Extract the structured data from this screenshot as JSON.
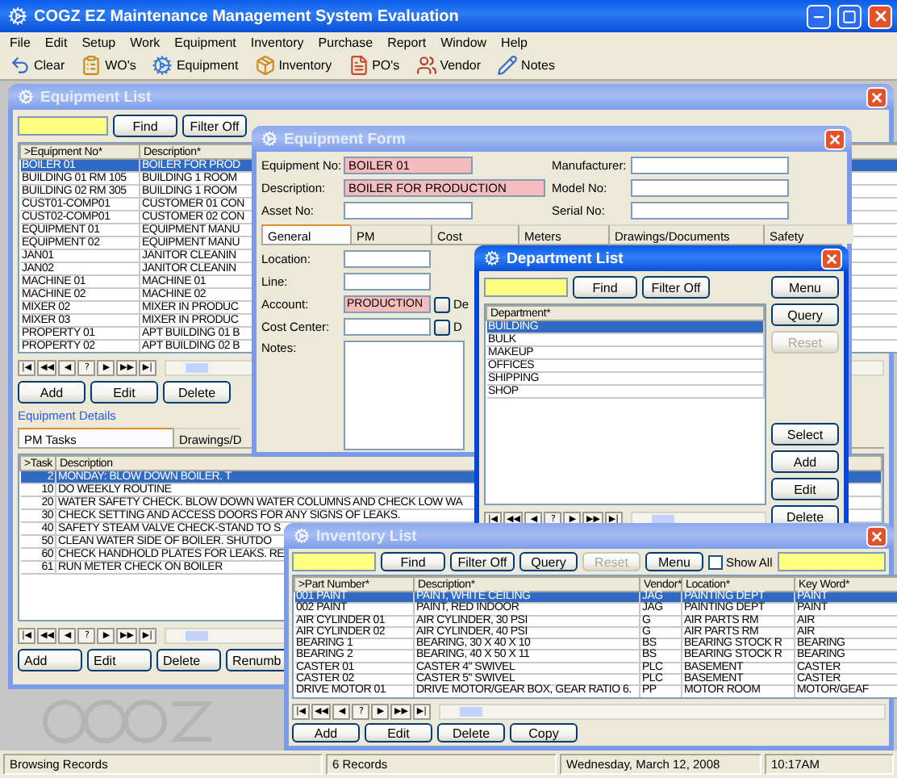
{
  "window": {
    "title": "COGZ EZ Maintenance Management System Evaluation"
  },
  "menu": [
    "File",
    "Edit",
    "Setup",
    "Work",
    "Equipment",
    "Inventory",
    "Purchase",
    "Report",
    "Window",
    "Help"
  ],
  "toolbar": [
    "Clear",
    "WO's",
    "Equipment",
    "Inventory",
    "PO's",
    "Vendor",
    "Notes"
  ],
  "equipment_list": {
    "title": "Equipment List",
    "active": false,
    "buttons": [
      "Find",
      "Filter Off"
    ],
    "columns": [
      ">Equipment No*",
      "Description*"
    ],
    "rows": [
      {
        "cells": [
          "BOILER 01",
          "BOILER FOR PROD"
        ],
        "selected": true
      },
      {
        "cells": [
          "BUILDING 01 RM 105",
          "BUILDING 1 ROOM"
        ],
        "selected": false
      },
      {
        "cells": [
          "BUILDING 02 RM 305",
          "BUILDING 1 ROOM"
        ],
        "selected": false
      },
      {
        "cells": [
          "CUST01-COMP01",
          "CUSTOMER 01 CON"
        ],
        "selected": false
      },
      {
        "cells": [
          "CUST02-COMP01",
          "CUSTOMER 02 CON"
        ],
        "selected": false
      },
      {
        "cells": [
          "EQUIPMENT 01",
          "EQUIPMENT MANU"
        ],
        "selected": false
      },
      {
        "cells": [
          "EQUIPMENT 02",
          "EQUIPMENT MANU"
        ],
        "selected": false
      },
      {
        "cells": [
          "JAN01",
          "JANITOR CLEANIN"
        ],
        "selected": false
      },
      {
        "cells": [
          "JAN02",
          "JANITOR CLEANIN"
        ],
        "selected": false
      },
      {
        "cells": [
          "MACHINE 01",
          "MACHINE 01"
        ],
        "selected": false
      },
      {
        "cells": [
          "MACHINE 02",
          "MACHINE 02"
        ],
        "selected": false
      },
      {
        "cells": [
          "MIXER 02",
          "MIXER IN PRODUC"
        ],
        "selected": false
      },
      {
        "cells": [
          "MIXER 03",
          "MIXER IN PRODUC"
        ],
        "selected": false
      },
      {
        "cells": [
          "PROPERTY 01",
          "APT BUILDING 01 B"
        ],
        "selected": false
      },
      {
        "cells": [
          "PROPERTY 02",
          "APT BUILDING 02 B"
        ],
        "selected": false
      }
    ],
    "navigator": [
      "|◀",
      "◀◀",
      "◀",
      "?",
      "▶",
      "▶▶",
      "▶|"
    ],
    "actions": [
      "Add",
      "Edit",
      "Delete"
    ],
    "details_label": "Equipment Details",
    "detail_tabs": [
      {
        "label": "PM Tasks",
        "selected": true
      },
      {
        "label": "Drawings/D",
        "selected": false
      }
    ],
    "task_columns": [
      ">Task",
      "Description"
    ],
    "tasks": [
      {
        "cells": [
          "2",
          "MONDAY: BLOW DOWN BOILER. T"
        ],
        "selected": true
      },
      {
        "cells": [
          "10",
          "DO WEEKLY ROUTINE"
        ],
        "selected": false
      },
      {
        "cells": [
          "20",
          "WATER SAFETY CHECK. BLOW DOWN WATER COLUMNS AND CHECK LOW WA"
        ],
        "selected": false
      },
      {
        "cells": [
          "30",
          "CHECK SETTING AND ACCESS DOORS FOR ANY SIGNS OF LEAKS."
        ],
        "selected": false
      },
      {
        "cells": [
          "40",
          "SAFETY STEAM VALVE CHECK-STAND TO S"
        ],
        "selected": false
      },
      {
        "cells": [
          "50",
          "CLEAN WATER SIDE OF BOILER. SHUTDO"
        ],
        "selected": false
      },
      {
        "cells": [
          "60",
          "CHECK HANDHOLD PLATES FOR LEAKS. RE"
        ],
        "selected": false
      },
      {
        "cells": [
          "61",
          "RUN METER CHECK ON BOILER"
        ],
        "selected": false
      }
    ],
    "task_navigator": [
      "|◀",
      "◀◀",
      "◀",
      "?",
      "▶",
      "▶▶",
      "▶|"
    ],
    "task_actions": [
      "Add",
      "Edit",
      "Delete",
      "Renumb"
    ]
  },
  "equipment_form": {
    "title": "Equipment Form",
    "active": false,
    "fields": [
      {
        "label": "Equipment No:",
        "value": "BOILER 01",
        "required": true
      },
      {
        "label": "Description:",
        "value": "BOILER FOR PRODUCTION",
        "required": true
      },
      {
        "label": "Asset No:",
        "required": false
      }
    ],
    "side_fields": [
      {
        "label": "Manufacturer:",
        "required": false
      },
      {
        "label": "Model No:",
        "required": false
      },
      {
        "label": "Serial No:",
        "required": false
      }
    ],
    "tabs": [
      {
        "label": "General",
        "selected": true
      },
      {
        "label": "PM",
        "selected": false
      },
      {
        "label": "Cost",
        "selected": false
      },
      {
        "label": "Meters",
        "selected": false
      },
      {
        "label": "Drawings/Documents",
        "selected": false
      },
      {
        "label": "Safety",
        "selected": false
      }
    ],
    "general_fields": [
      {
        "kind": "text",
        "label": "Location:",
        "required": false
      },
      {
        "kind": "text",
        "label": "Line:",
        "required": false
      },
      {
        "kind": "lookup",
        "label": "Account:",
        "value": "PRODUCTION",
        "required": true,
        "lookup_label": "De"
      },
      {
        "kind": "lookup",
        "label": "Cost Center:",
        "required": false,
        "lookup_label": "D"
      },
      {
        "kind": "notes",
        "label": "Notes:"
      }
    ]
  },
  "department_list": {
    "title": "Department List",
    "active": true,
    "buttons": [
      "Find",
      "Filter Off"
    ],
    "columns": [
      "Department*"
    ],
    "rows": [
      {
        "cells": [
          "BUILDING"
        ],
        "selected": true
      },
      {
        "cells": [
          "BULK"
        ],
        "selected": false
      },
      {
        "cells": [
          "MAKEUP"
        ],
        "selected": false
      },
      {
        "cells": [
          "OFFICES"
        ],
        "selected": false
      },
      {
        "cells": [
          "SHIPPING"
        ],
        "selected": false
      },
      {
        "cells": [
          "SHOP"
        ],
        "selected": false
      }
    ],
    "navigator": [
      "|◀",
      "◀◀",
      "◀",
      "?",
      "▶",
      "▶▶",
      "▶|"
    ],
    "side_buttons": [
      {
        "label": "Menu",
        "disabled": false
      },
      {
        "label": "Query",
        "disabled": false
      },
      {
        "label": "Reset",
        "disabled": true
      }
    ],
    "action_buttons": [
      {
        "label": "Select",
        "disabled": false
      },
      {
        "label": "Add",
        "disabled": false
      },
      {
        "label": "Edit",
        "disabled": false
      },
      {
        "label": "Delete",
        "disabled": false
      }
    ]
  },
  "inventory_list": {
    "title": "Inventory List",
    "active": false,
    "buttons": [
      {
        "label": "Find",
        "disabled": false
      },
      {
        "label": "Filter Off",
        "disabled": false
      },
      {
        "label": "Query",
        "disabled": false
      },
      {
        "label": "Reset",
        "disabled": true
      },
      {
        "label": "Menu",
        "disabled": false
      }
    ],
    "show_all": {
      "label": "Show All",
      "checked": false
    },
    "columns": [
      ">Part Number*",
      "Description*",
      "Vendor*",
      "Location*",
      "Key Word*"
    ],
    "rows": [
      {
        "cells": [
          "001 PAINT",
          "PAINT, WHITE CEILING",
          "JAG",
          "PAINTING DEPT",
          "PAINT"
        ],
        "selected": true
      },
      {
        "cells": [
          "002 PAINT",
          "PAINT, RED INDOOR",
          "JAG",
          "PAINTING DEPT",
          "PAINT"
        ],
        "selected": false
      },
      {
        "cells": [
          "AIR CYLINDER 01",
          "AIR CYLINDER, 30 PSI",
          "G",
          "AIR PARTS RM",
          "AIR"
        ],
        "selected": false
      },
      {
        "cells": [
          "AIR CYLINDER 02",
          "AIR CYLINDER, 40 PSI",
          "G",
          "AIR PARTS RM",
          "AIR"
        ],
        "selected": false
      },
      {
        "cells": [
          "BEARING 1",
          "BEARING, 30 X 40 X 10",
          "BS",
          "BEARING STOCK R",
          "BEARING"
        ],
        "selected": false
      },
      {
        "cells": [
          "BEARING 2",
          "BEARING, 40 X 50 X 11",
          "BS",
          "BEARING STOCK R",
          "BEARING"
        ],
        "selected": false
      },
      {
        "cells": [
          "CASTER 01",
          "CASTER 4\" SWIVEL",
          "PLC",
          "BASEMENT",
          "CASTER"
        ],
        "selected": false
      },
      {
        "cells": [
          "CASTER 02",
          "CASTER 5\" SWIVEL",
          "PLC",
          "BASEMENT",
          "CASTER"
        ],
        "selected": false
      },
      {
        "cells": [
          "DRIVE MOTOR 01",
          "DRIVE MOTOR/GEAR BOX, GEAR RATIO 6.",
          "PP",
          "MOTOR ROOM",
          "MOTOR/GEAF"
        ],
        "selected": false
      }
    ],
    "navigator": [
      "|◀",
      "◀◀",
      "◀",
      "?",
      "▶",
      "▶▶",
      "▶|"
    ],
    "actions": [
      "Add",
      "Edit",
      "Delete",
      "Copy"
    ]
  },
  "status_bar": [
    "Browsing Records",
    "6 Records",
    "Wednesday, March 12, 2008",
    "10:17AM"
  ]
}
